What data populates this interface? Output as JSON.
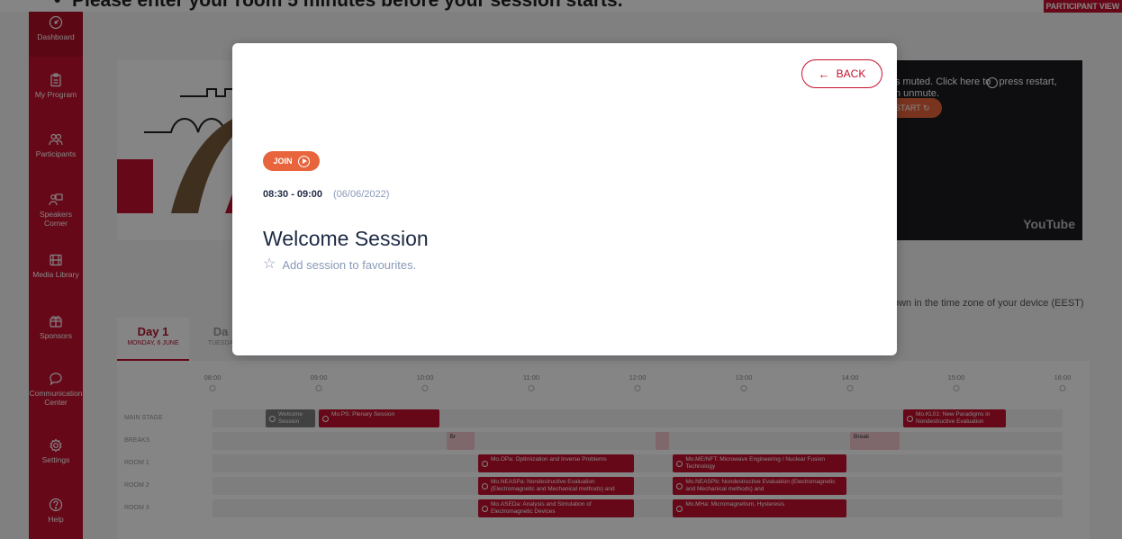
{
  "instruction": {
    "bullet": "•",
    "text": "Please enter your room 5 minutes before your session starts."
  },
  "header": {
    "badge": "PARTICIPANT VIEW"
  },
  "sidebar": {
    "items": [
      {
        "label": "Dashboard",
        "icon": "dashboard-gauge-icon"
      },
      {
        "label": "My Program",
        "icon": "clipboard-icon"
      },
      {
        "label": "Participants",
        "icon": "users-icon"
      },
      {
        "label": "Speakers Corner",
        "icon": "presentation-icon"
      },
      {
        "label": "Media Library",
        "icon": "film-icon"
      },
      {
        "label": "Sponsors",
        "icon": "gift-icon"
      },
      {
        "label": "Communication Center",
        "icon": "chat-icon"
      },
      {
        "label": "Settings",
        "icon": "gear-icon"
      },
      {
        "label": "Help",
        "icon": "question-icon"
      }
    ]
  },
  "video": {
    "muted_text": "s muted. Click here to",
    "unmute_text": "n unmute.",
    "restart_label": "START",
    "press_text": "press restart,",
    "logo": "YouTube"
  },
  "timezone_note": "own in the time zone of your device (EEST)",
  "days": [
    {
      "title": "Day 1",
      "subtitle": "MONDAY, 6 JUNE"
    },
    {
      "title": "Da",
      "subtitle": "TUESDA"
    }
  ],
  "schedule": {
    "times": [
      "08:00",
      "09:00",
      "10:00",
      "11:00",
      "12:00",
      "13:00",
      "14:00",
      "15:00",
      "16:00"
    ],
    "tracks": [
      {
        "name": "MAIN STAGE",
        "events": [
          {
            "label": "Welcome Session",
            "start": "08:30",
            "end": "09:00",
            "style": "grey"
          },
          {
            "label": "Mo.PS: Plenary Session",
            "start": "09:00",
            "end": "10:10",
            "style": "red"
          },
          {
            "label": "Mo.KL01: New Paradigms in Nondestructive Evaluation",
            "start": "14:30",
            "end": "15:30",
            "style": "red"
          }
        ]
      },
      {
        "name": "BREAKS",
        "events": [
          {
            "label": "Br",
            "start": "10:12",
            "end": "10:30",
            "style": "pale"
          },
          {
            "label": "",
            "start": "12:10",
            "end": "12:20",
            "style": "pale"
          },
          {
            "label": "Break",
            "start": "14:00",
            "end": "14:30",
            "style": "pale"
          }
        ]
      },
      {
        "name": "ROOM 1",
        "events": [
          {
            "label": "Mo.OPa: Optimization and Inverse Problems",
            "start": "10:30",
            "end": "12:00",
            "style": "red"
          },
          {
            "label": "Mo.ME/NFT: Microwave Engineering / Nuclear Fusion Technology",
            "start": "12:20",
            "end": "14:00",
            "style": "red"
          }
        ]
      },
      {
        "name": "ROOM 2",
        "events": [
          {
            "label": "Mo.NEASPa: Nondestructive Evaluation (Electromagnetic and Mechanical methods) and",
            "start": "10:30",
            "end": "12:00",
            "style": "red"
          },
          {
            "label": "Mo.NEASPb: Nondestructive Evaluation (Electromagnetic and Mechanical methods) and",
            "start": "12:20",
            "end": "14:00",
            "style": "red"
          }
        ]
      },
      {
        "name": "ROOM 3",
        "events": [
          {
            "label": "Mo.ASEDa: Analysis and Simulation of Electromagnetic Devices",
            "start": "10:30",
            "end": "12:00",
            "style": "red"
          },
          {
            "label": "Mo.MHa: Micromagnetism, Hysteresis",
            "start": "12:20",
            "end": "14:00",
            "style": "red"
          }
        ]
      }
    ]
  },
  "modal": {
    "back_label": "BACK",
    "join_label": "JOIN",
    "time": "08:30 - 09:00",
    "date": "(06/06/2022)",
    "title": "Welcome Session",
    "favourite_label": "Add session to favourites."
  },
  "colors": {
    "brand": "#c6102e",
    "join": "#e8643c",
    "title": "#1e2a44",
    "muted": "#8a9ab8"
  }
}
